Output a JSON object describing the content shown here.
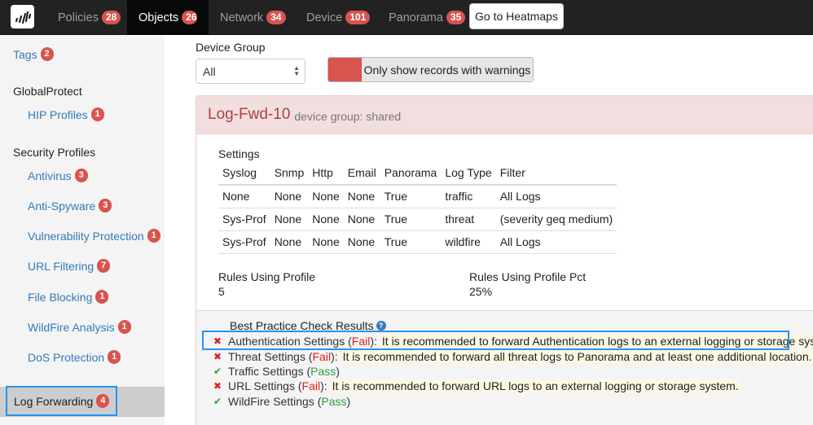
{
  "navbar": {
    "logo_icon": "palo-alto-logo-icon",
    "items": [
      {
        "label": "Policies",
        "count": "28",
        "active": false
      },
      {
        "label": "Objects",
        "count": "26",
        "active": true
      },
      {
        "label": "Network",
        "count": "34",
        "active": false
      },
      {
        "label": "Device",
        "count": "101",
        "active": false
      },
      {
        "label": "Panorama",
        "count": "35",
        "active": false
      }
    ],
    "heatmap_button": "Go to Heatmaps"
  },
  "sidebar": {
    "tags": {
      "label": "Tags",
      "count": "2"
    },
    "globalprotect": {
      "heading": "GlobalProtect",
      "items": [
        {
          "label": "HIP Profiles",
          "count": "1"
        }
      ]
    },
    "security_profiles": {
      "heading": "Security Profiles",
      "items": [
        {
          "label": "Antivirus",
          "count": "3"
        },
        {
          "label": "Anti-Spyware",
          "count": "3"
        },
        {
          "label": "Vulnerability Protection",
          "count": "1"
        },
        {
          "label": "URL Filtering",
          "count": "7"
        },
        {
          "label": "File Blocking",
          "count": "1"
        },
        {
          "label": "WildFire Analysis",
          "count": "1"
        },
        {
          "label": "DoS Protection",
          "count": "1"
        }
      ]
    },
    "active_item": {
      "label": "Log Forwarding",
      "count": "4"
    }
  },
  "filters": {
    "device_group_label": "Device Group",
    "device_group_value": "All",
    "warnings_toggle_label": "Only show records with warnings",
    "warnings_toggle_color": "#d9534f"
  },
  "record": {
    "name": "Log-Fwd-10",
    "device_group_text": "device group: shared",
    "settings_label": "Settings",
    "columns": [
      "Syslog",
      "Snmp",
      "Http",
      "Email",
      "Panorama",
      "Log Type",
      "Filter"
    ],
    "rows": [
      [
        "None",
        "None",
        "None",
        "None",
        "True",
        "traffic",
        "All Logs"
      ],
      [
        "Sys-Prof",
        "None",
        "None",
        "None",
        "True",
        "threat",
        "(severity geq medium)"
      ],
      [
        "Sys-Prof",
        "None",
        "None",
        "None",
        "True",
        "wildfire",
        "All Logs"
      ]
    ],
    "rules_using_profile_label": "Rules Using Profile",
    "rules_using_profile_value": "5",
    "rules_using_profile_pct_label": "Rules Using Profile Pct",
    "rules_using_profile_pct_value": "25%"
  },
  "best_practice": {
    "title": "Best Practice Check Results",
    "help_icon": "question-circle-icon",
    "results": [
      {
        "name": "Authentication Settings",
        "status": "Fail",
        "message": "It is recommended to forward Authentication logs to an external logging or storage system."
      },
      {
        "name": "Threat Settings",
        "status": "Fail",
        "message": "It is recommended to forward all threat logs to Panorama and at least one additional location."
      },
      {
        "name": "Traffic Settings",
        "status": "Pass",
        "message": ""
      },
      {
        "name": "URL Settings",
        "status": "Fail",
        "message": "It is recommended to forward URL logs to an external logging or storage system."
      },
      {
        "name": "WildFire Settings",
        "status": "Pass",
        "message": ""
      }
    ]
  },
  "colors": {
    "badge": "#d9534f",
    "link": "#337ab7",
    "fail": "#e02020",
    "pass": "#2e9e3e",
    "highlight_outline": "#2196f3",
    "panel_danger_bg": "#f2dede"
  }
}
